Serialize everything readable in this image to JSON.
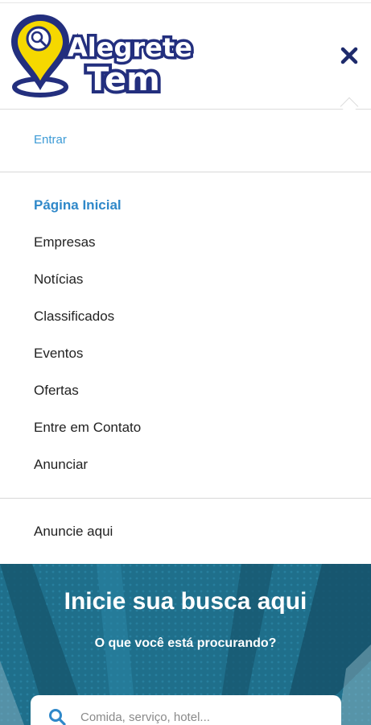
{
  "logo": {
    "line1": "Alegrete",
    "line2": "Tem"
  },
  "colors": {
    "brand_navy": "#232f7e",
    "brand_yellow": "#f5d800",
    "accent_blue": "#2f88c9",
    "hero_bg": "#1f6f8b"
  },
  "header": {
    "close_icon": "close-icon"
  },
  "login": {
    "label": "Entrar"
  },
  "nav": {
    "items": [
      {
        "label": "Página Inicial",
        "active": true
      },
      {
        "label": "Empresas"
      },
      {
        "label": "Notícias"
      },
      {
        "label": "Classificados"
      },
      {
        "label": "Eventos"
      },
      {
        "label": "Ofertas"
      },
      {
        "label": "Entre em Contato"
      },
      {
        "label": "Anunciar"
      }
    ]
  },
  "anuncie": {
    "label": "Anuncie aqui"
  },
  "hero": {
    "title": "Inicie sua busca aqui",
    "subtitle": "O que você está procurando?",
    "search_placeholder": "Comida, serviço, hotel..."
  }
}
